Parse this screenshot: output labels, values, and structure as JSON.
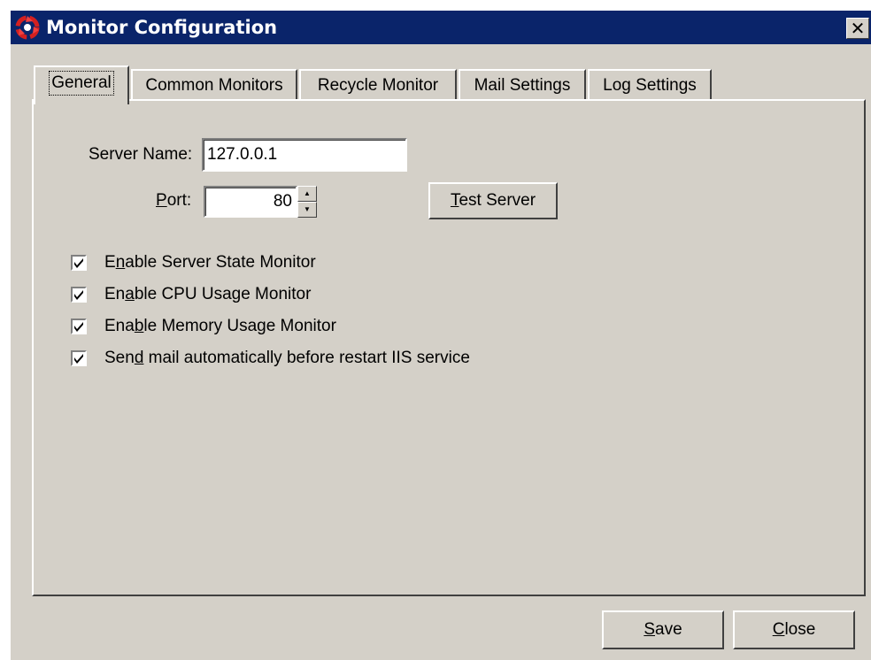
{
  "window": {
    "title": "Monitor Configuration",
    "close_label": "✕"
  },
  "tabs": [
    {
      "label": "General",
      "active": true
    },
    {
      "label": "Common Monitors",
      "active": false
    },
    {
      "label": "Recycle Monitor",
      "active": false
    },
    {
      "label": "Mail Settings",
      "active": false
    },
    {
      "label": "Log Settings",
      "active": false
    }
  ],
  "general": {
    "server_name_label": "Server Name:",
    "server_name_value": "127.0.0.1",
    "port_label": "Port:",
    "port_value": "80",
    "test_server_label": "Test Server",
    "checkboxes": [
      {
        "label": "Enable Server State Monitor",
        "checked": true
      },
      {
        "label": "Enable CPU Usage Monitor",
        "checked": true
      },
      {
        "label": "Enable Memory Usage Monitor",
        "checked": true
      },
      {
        "label": "Send mail automatically before restart IIS service",
        "checked": true
      }
    ]
  },
  "footer": {
    "save_label": "Save",
    "close_label": "Close"
  },
  "colors": {
    "titlebar": "#0a246a",
    "face": "#d4d0c8",
    "icon_red": "#d42020"
  }
}
